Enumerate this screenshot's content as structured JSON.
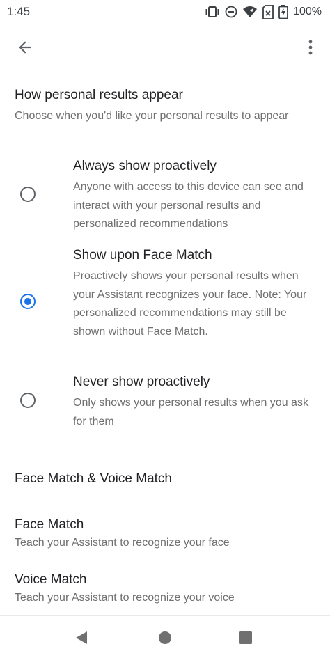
{
  "status_bar": {
    "time": "1:45",
    "battery_percent": "100%",
    "icons": [
      "vibrate-icon",
      "do-not-disturb-icon",
      "wifi-icon",
      "sim-x-icon",
      "battery-charging-icon"
    ]
  },
  "app_bar": {
    "back_icon": "arrow-back-icon",
    "more_icon": "more-vert-icon"
  },
  "personal_results": {
    "title": "How personal results appear",
    "subtitle": "Choose when you'd like your personal results to appear",
    "options": [
      {
        "title": "Always show proactively",
        "description": "Anyone with access to this device can see and interact with your personal results and personalized recommendations",
        "selected": false
      },
      {
        "title": "Show upon Face Match",
        "description": "Proactively shows your personal results when your Assistant recognizes your face. Note: Your personalized recommendations may still be shown without Face Match.",
        "selected": true
      },
      {
        "title": "Never show proactively",
        "description": "Only shows your personal results when you ask for them",
        "selected": false
      }
    ]
  },
  "match_section": {
    "header": "Face Match & Voice Match",
    "items": [
      {
        "title": "Face Match",
        "subtitle": "Teach your Assistant to recognize your face"
      },
      {
        "title": "Voice Match",
        "subtitle": "Teach your Assistant to recognize your voice"
      }
    ]
  },
  "nav_bar": {
    "icons": [
      "back-triangle-icon",
      "home-circle-icon",
      "recents-square-icon"
    ]
  },
  "colors": {
    "accent": "#1a73e8",
    "text_primary": "#202124",
    "text_secondary": "#6f6f6f",
    "divider": "#dadce0"
  }
}
